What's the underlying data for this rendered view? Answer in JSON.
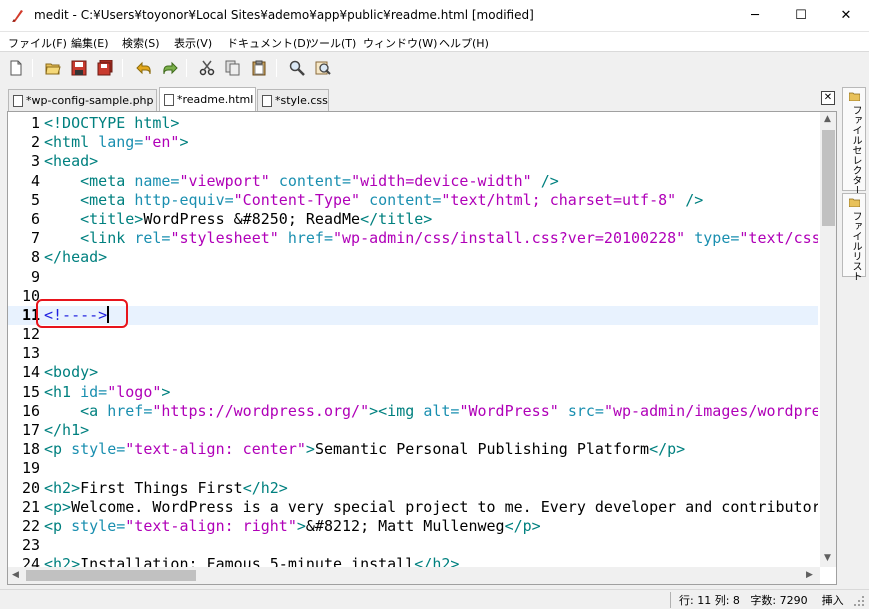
{
  "window": {
    "title": "medit - C:¥Users¥toyonor¥Local Sites¥ademo¥app¥public¥readme.html [modified]",
    "minimize": "─",
    "maximize": "☐",
    "close": "✕"
  },
  "menu": [
    "ファイル(F)",
    "編集(E)",
    "検索(S)",
    "表示(V)",
    "ドキュメント(D)",
    "ツール(T)",
    "ウィンドウ(W)",
    "ヘルプ(H)"
  ],
  "toolbar_icons": [
    "new-icon",
    "open-icon",
    "save-icon",
    "save-all-icon",
    "undo-icon",
    "redo-icon",
    "cut-icon",
    "copy-icon",
    "paste-icon",
    "find-icon",
    "replace-icon"
  ],
  "tabs": [
    {
      "label": "*wp-config-sample.php",
      "active": false
    },
    {
      "label": "*readme.html",
      "active": true
    },
    {
      "label": "*style.css",
      "active": false
    }
  ],
  "tab_close": "✕",
  "side_panels": [
    "ファイルセレクター",
    "ファイルリスト"
  ],
  "editor": {
    "current_line": 11,
    "lines": [
      {
        "n": "1",
        "parts": [
          [
            "tag",
            "<!DOCTYPE html>"
          ]
        ]
      },
      {
        "n": "2",
        "parts": [
          [
            "tag",
            "<html "
          ],
          [
            "attr",
            "lang="
          ],
          [
            "val",
            "\"en\""
          ],
          [
            "tag",
            ">"
          ]
        ]
      },
      {
        "n": "3",
        "parts": [
          [
            "tag",
            "<head>"
          ]
        ]
      },
      {
        "n": "4",
        "parts": [
          [
            "txt",
            "    "
          ],
          [
            "tag",
            "<meta "
          ],
          [
            "attr",
            "name="
          ],
          [
            "val",
            "\"viewport\""
          ],
          [
            "txt",
            " "
          ],
          [
            "attr",
            "content="
          ],
          [
            "val",
            "\"width=device-width\""
          ],
          [
            "tag",
            " />"
          ]
        ]
      },
      {
        "n": "5",
        "parts": [
          [
            "txt",
            "    "
          ],
          [
            "tag",
            "<meta "
          ],
          [
            "attr",
            "http-equiv="
          ],
          [
            "val",
            "\"Content-Type\""
          ],
          [
            "txt",
            " "
          ],
          [
            "attr",
            "content="
          ],
          [
            "val",
            "\"text/html; charset=utf-8\""
          ],
          [
            "tag",
            " />"
          ]
        ]
      },
      {
        "n": "6",
        "parts": [
          [
            "txt",
            "    "
          ],
          [
            "tag",
            "<title>"
          ],
          [
            "txt",
            "WordPress &#8250; ReadMe"
          ],
          [
            "tag",
            "</title>"
          ]
        ]
      },
      {
        "n": "7",
        "parts": [
          [
            "txt",
            "    "
          ],
          [
            "tag",
            "<link "
          ],
          [
            "attr",
            "rel="
          ],
          [
            "val",
            "\"stylesheet\""
          ],
          [
            "txt",
            " "
          ],
          [
            "attr",
            "href="
          ],
          [
            "val",
            "\"wp-admin/css/install.css?ver=20100228\""
          ],
          [
            "txt",
            " "
          ],
          [
            "attr",
            "type="
          ],
          [
            "val",
            "\"text/css\""
          ]
        ]
      },
      {
        "n": "8",
        "parts": [
          [
            "tag",
            "</head>"
          ]
        ]
      },
      {
        "n": "9",
        "parts": []
      },
      {
        "n": "10",
        "parts": []
      },
      {
        "n": "11",
        "parts": [
          [
            "cmt",
            "<!---->"
          ]
        ],
        "caret": true
      },
      {
        "n": "12",
        "parts": []
      },
      {
        "n": "13",
        "parts": []
      },
      {
        "n": "14",
        "parts": [
          [
            "tag",
            "<body>"
          ]
        ]
      },
      {
        "n": "15",
        "parts": [
          [
            "tag",
            "<h1 "
          ],
          [
            "attr",
            "id="
          ],
          [
            "val",
            "\"logo\""
          ],
          [
            "tag",
            ">"
          ]
        ]
      },
      {
        "n": "16",
        "parts": [
          [
            "txt",
            "    "
          ],
          [
            "tag",
            "<a "
          ],
          [
            "attr",
            "href="
          ],
          [
            "val",
            "\"https://wordpress.org/\""
          ],
          [
            "tag",
            "><img "
          ],
          [
            "attr",
            "alt="
          ],
          [
            "val",
            "\"WordPress\""
          ],
          [
            "txt",
            " "
          ],
          [
            "attr",
            "src="
          ],
          [
            "val",
            "\"wp-admin/images/wordpress-logo.png\""
          ]
        ]
      },
      {
        "n": "17",
        "parts": [
          [
            "tag",
            "</h1>"
          ]
        ]
      },
      {
        "n": "18",
        "parts": [
          [
            "tag",
            "<p "
          ],
          [
            "attr",
            "style="
          ],
          [
            "val",
            "\"text-align: center\""
          ],
          [
            "tag",
            ">"
          ],
          [
            "txt",
            "Semantic Personal Publishing Platform"
          ],
          [
            "tag",
            "</p>"
          ]
        ]
      },
      {
        "n": "19",
        "parts": []
      },
      {
        "n": "20",
        "parts": [
          [
            "tag",
            "<h2>"
          ],
          [
            "txt",
            "First Things First"
          ],
          [
            "tag",
            "</h2>"
          ]
        ]
      },
      {
        "n": "21",
        "parts": [
          [
            "tag",
            "<p>"
          ],
          [
            "txt",
            "Welcome. WordPress is a very special project to me. Every developer and contributor"
          ]
        ]
      },
      {
        "n": "22",
        "parts": [
          [
            "tag",
            "<p "
          ],
          [
            "attr",
            "style="
          ],
          [
            "val",
            "\"text-align: right\""
          ],
          [
            "tag",
            ">"
          ],
          [
            "txt",
            "&#8212; Matt Mullenweg"
          ],
          [
            "tag",
            "</p>"
          ]
        ]
      },
      {
        "n": "23",
        "parts": []
      },
      {
        "n": "24",
        "parts": [
          [
            "tag",
            "<h2>"
          ],
          [
            "txt",
            "Installation: Famous 5-minute install"
          ],
          [
            "tag",
            "</h2>"
          ]
        ]
      }
    ]
  },
  "status": {
    "position": "行: 11 列: 8",
    "chars": "字数: 7290",
    "mode": "挿入"
  }
}
